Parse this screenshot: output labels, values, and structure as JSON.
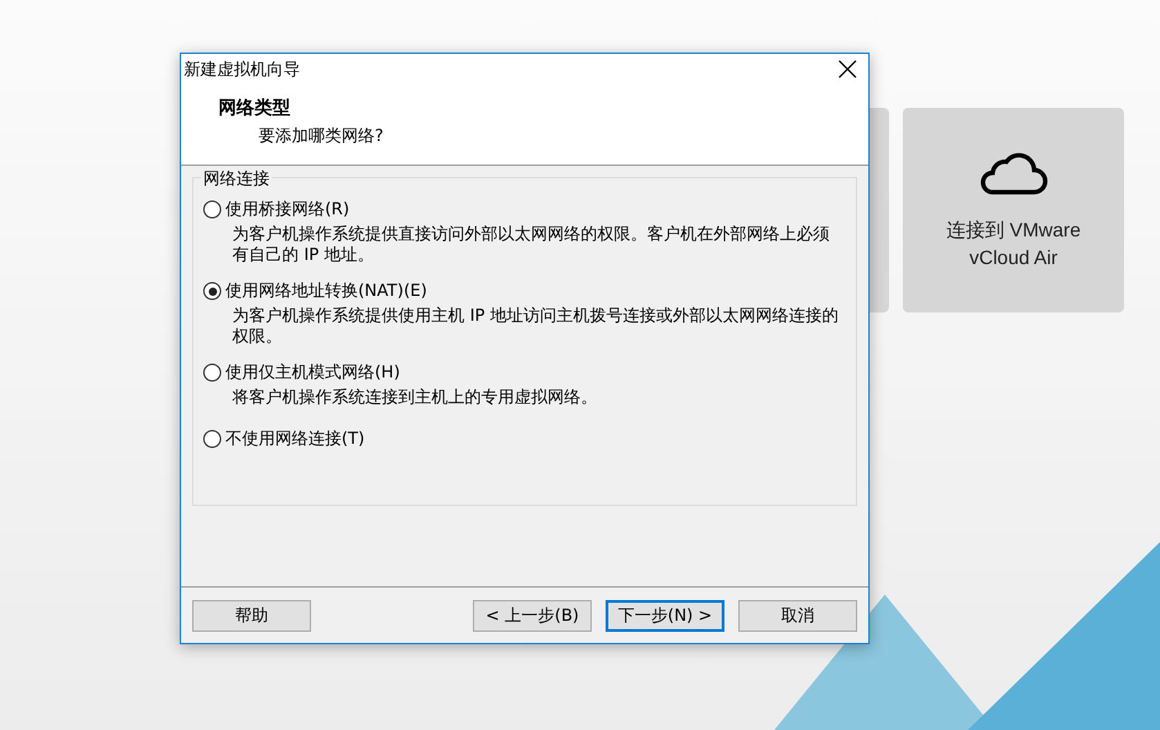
{
  "cards": [
    {
      "kind": "blank"
    },
    {
      "kind": "cloud",
      "label_lines": [
        "连接到 VMware",
        "vCloud Air"
      ]
    }
  ],
  "dialog": {
    "title": "新建虚拟机向导",
    "heading": "网络类型",
    "subheading": "要添加哪类网络?",
    "group": {
      "label": "网络连接",
      "options": [
        {
          "label": "使用桥接网络(R)",
          "description": "为客户机操作系统提供直接访问外部以太网网络的权限。客户机在外部网络上必须有自己的 IP 地址。",
          "selected": false
        },
        {
          "label": "使用网络地址转换(NAT)(E)",
          "description": "为客户机操作系统提供使用主机 IP 地址访问主机拨号连接或外部以太网网络连接的权限。",
          "selected": true
        },
        {
          "label": "使用仅主机模式网络(H)",
          "description": "将客户机操作系统连接到主机上的专用虚拟网络。",
          "selected": false
        },
        {
          "label": "不使用网络连接(T)",
          "selected": false
        }
      ]
    },
    "buttons": [
      {
        "label": "帮助",
        "default": false
      },
      {
        "label": "< 上一步(B)",
        "default": false
      },
      {
        "label": "下一步(N) >",
        "default": true
      },
      {
        "label": "取消",
        "default": false
      }
    ]
  }
}
